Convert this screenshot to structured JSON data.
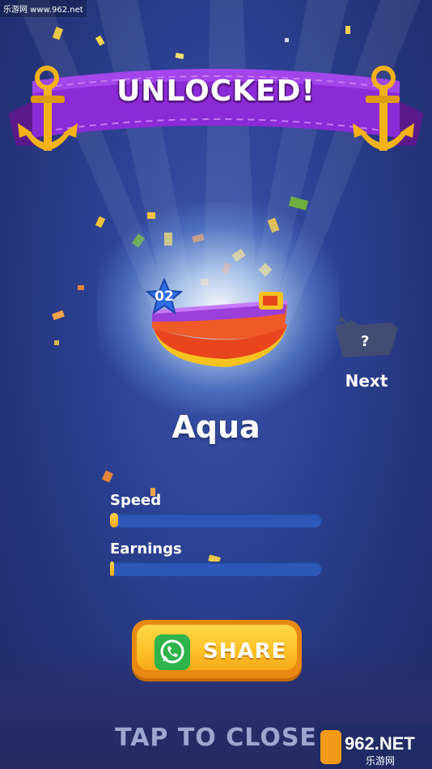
{
  "watermark": "乐游网 www.962.net",
  "banner": {
    "title": "UNLOCKED!"
  },
  "boat": {
    "level": "02",
    "name": "Aqua"
  },
  "next": {
    "label": "Next",
    "mystery": "?"
  },
  "stats": [
    {
      "label": "Speed",
      "fraction": 0.04
    },
    {
      "label": "Earnings",
      "fraction": 0.015
    }
  ],
  "share": {
    "label": "SHARE",
    "icon": "whatsapp-icon"
  },
  "tap_to_close": "TAP TO CLOSE",
  "site_logo": {
    "text": "962.NET",
    "subtext": "乐游网"
  },
  "colors": {
    "background": "#2e4396",
    "banner_purple": "#8b2bd6",
    "anchor_gold": "#f2b21a",
    "button_yellow": "#ffc32a",
    "bar_blue": "#2e58b8",
    "bar_fill": "#f2a516"
  }
}
